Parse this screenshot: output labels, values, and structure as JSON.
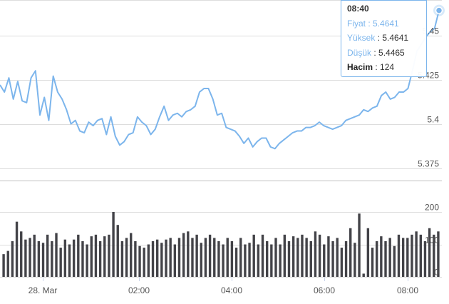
{
  "chart_data": [
    {
      "type": "line",
      "title": "",
      "xlabel": "",
      "ylabel": "",
      "ylim": [
        5.368,
        5.47
      ],
      "yticks": [
        "5.375",
        "5.4",
        "5.425",
        "5.45"
      ],
      "x_tick_labels": [
        "28. Mar",
        "02:00",
        "04:00",
        "06:00",
        "08:00"
      ],
      "grid": true,
      "color": "#7cb5ec",
      "series": [
        {
          "values": [
            5.422,
            5.418,
            5.426,
            5.414,
            5.424,
            5.413,
            5.412,
            5.426,
            5.43,
            5.405,
            5.415,
            5.402,
            5.427,
            5.418,
            5.414,
            5.408,
            5.4,
            5.402,
            5.396,
            5.395,
            5.401,
            5.399,
            5.402,
            5.403,
            5.394,
            5.404,
            5.393,
            5.388,
            5.39,
            5.394,
            5.395,
            5.404,
            5.401,
            5.399,
            5.394,
            5.397,
            5.404,
            5.41,
            5.402,
            5.405,
            5.406,
            5.404,
            5.407,
            5.408,
            5.41,
            5.418,
            5.42,
            5.42,
            5.414,
            5.405,
            5.406,
            5.398,
            5.397,
            5.396,
            5.393,
            5.389,
            5.392,
            5.387,
            5.39,
            5.392,
            5.392,
            5.387,
            5.386,
            5.389,
            5.391,
            5.393,
            5.395,
            5.396,
            5.396,
            5.398,
            5.398,
            5.399,
            5.401,
            5.399,
            5.398,
            5.397,
            5.398,
            5.399,
            5.402,
            5.403,
            5.404,
            5.405,
            5.408,
            5.407,
            5.409,
            5.41,
            5.416,
            5.418,
            5.414,
            5.415,
            5.418,
            5.418,
            5.42,
            5.43,
            5.441,
            5.445,
            5.449,
            5.452,
            5.454,
            5.4641
          ]
        }
      ]
    },
    {
      "type": "bar",
      "title": "",
      "ylim": [
        0,
        200
      ],
      "yticks": [
        "0",
        "100",
        "200"
      ],
      "color": "#434348",
      "values": [
        70,
        80,
        110,
        170,
        140,
        115,
        120,
        130,
        110,
        105,
        130,
        110,
        135,
        90,
        115,
        100,
        115,
        130,
        110,
        100,
        125,
        130,
        110,
        125,
        130,
        200,
        160,
        110,
        120,
        135,
        110,
        95,
        90,
        100,
        110,
        115,
        105,
        115,
        120,
        100,
        120,
        135,
        140,
        120,
        130,
        105,
        120,
        130,
        120,
        110,
        100,
        120,
        110,
        90,
        120,
        100,
        105,
        130,
        100,
        130,
        110,
        100,
        120,
        100,
        130,
        110,
        125,
        120,
        130,
        120,
        110,
        140,
        130,
        100,
        125,
        110,
        120,
        90,
        110,
        150,
        105,
        195,
        10,
        150,
        90,
        110,
        125,
        110,
        120,
        95,
        130,
        120,
        120,
        130,
        140,
        130,
        110,
        150,
        130,
        140
      ]
    }
  ],
  "tooltip": {
    "time": "08:40",
    "price_label": "Fiyat",
    "price_value": "5.4641",
    "high_label": "Yüksek",
    "high_value": "5.4641",
    "low_label": "Düşük",
    "low_value": "5.4465",
    "volume_label": "Hacim",
    "volume_value": "124"
  }
}
